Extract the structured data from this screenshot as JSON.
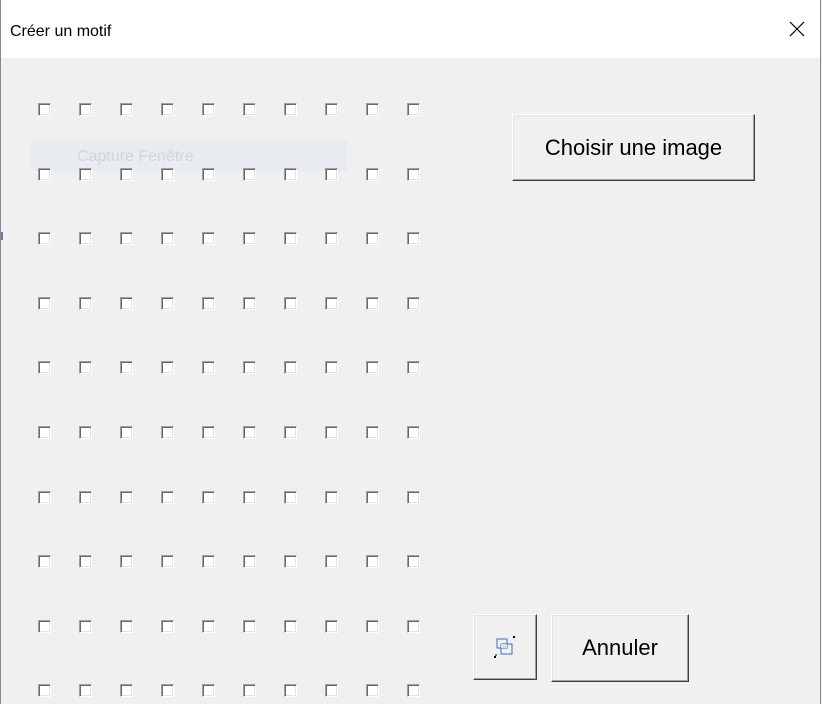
{
  "window": {
    "title": "Créer un motif",
    "close_icon": "close-icon"
  },
  "ghost": {
    "label": "Capture Fenêtre"
  },
  "grid": {
    "rows": 10,
    "cols": 10,
    "checked": []
  },
  "buttons": {
    "choose_image_label": "Choisir une image",
    "icon_button_icon": "screen-capture-icon",
    "cancel_label": "Annuler"
  }
}
